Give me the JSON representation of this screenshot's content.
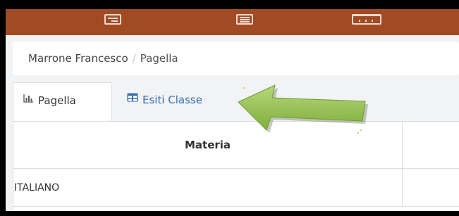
{
  "topbar": {
    "color": "#a14b25",
    "icons": [
      "card-list-icon",
      "list-icon",
      "grid-table-icon"
    ]
  },
  "breadcrumb": {
    "parent": "Marrone Francesco",
    "separator": "/",
    "current": "Pagella"
  },
  "tabs": [
    {
      "label": "Pagella",
      "icon": "bar-chart-icon",
      "active": true
    },
    {
      "label": "Esiti Classe",
      "icon": "table-icon",
      "active": false
    }
  ],
  "table": {
    "headers": [
      "Materia",
      ""
    ],
    "rows": [
      [
        "ITALIANO",
        ""
      ]
    ]
  },
  "annotation": {
    "icon": "green-arrow-icon",
    "color": "#8fbf4a"
  }
}
